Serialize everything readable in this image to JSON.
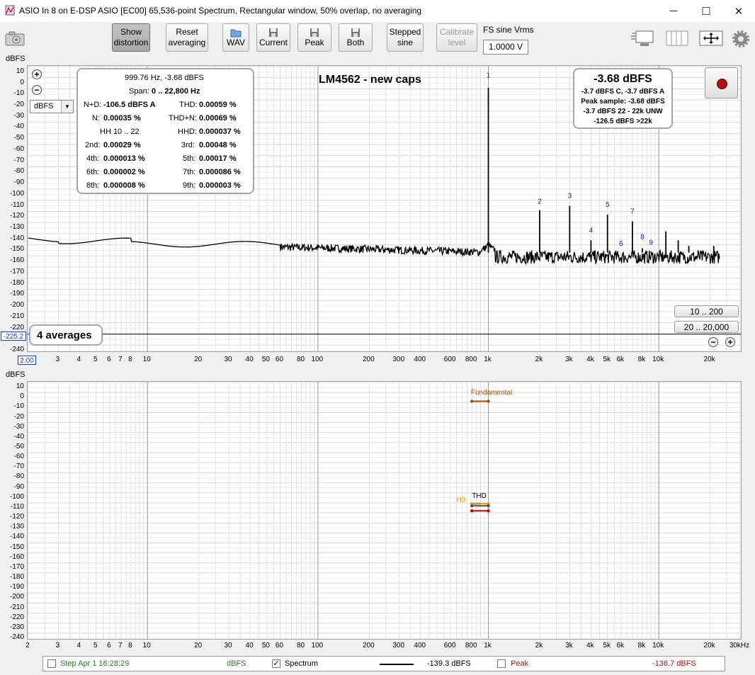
{
  "window": {
    "title": "ASIO In 8 on E-DSP ASIO [EC00] 65,536-point Spectrum, Rectangular window, 50% overlap, no averaging",
    "minimize": "─",
    "maximize": "☐",
    "close": "✕"
  },
  "toolbar": {
    "show_distortion_1": "Show",
    "show_distortion_2": "distortion",
    "reset_1": "Reset",
    "reset_2": "averaging",
    "wav": "WAV",
    "current": "Current",
    "peak": "Peak",
    "both": "Both",
    "stepped_1": "Stepped",
    "stepped_2": "sine",
    "calibrate_1": "Calibrate",
    "calibrate_2": "level",
    "fs_label": "FS sine Vrms",
    "fs_value": "1.0000 V"
  },
  "top_plot": {
    "title": "LM4562 - new caps",
    "unit_label": "dBFS",
    "unit_select": "dBFS",
    "y_ticks": [
      "10",
      "0",
      "-10",
      "-20",
      "-30",
      "-40",
      "-50",
      "-60",
      "-70",
      "-80",
      "-90",
      "-100",
      "-110",
      "-120",
      "-130",
      "-140",
      "-150",
      "-160",
      "-170",
      "-180",
      "-190",
      "-200",
      "-210",
      "-220",
      "-230",
      "-240"
    ],
    "y_cursor": "-225.2",
    "x_cursor": "2.00",
    "averages": "4 averages",
    "range_1": "10 .. 200",
    "range_2": "20 .. 20,000",
    "harmonic_labels": [
      "1",
      "2",
      "3",
      "4",
      "5",
      "6",
      "7",
      "8",
      "9"
    ]
  },
  "x_ticks": [
    "3",
    "4",
    "5",
    "6",
    "7",
    "8",
    "10",
    "20",
    "30",
    "40",
    "50",
    "60",
    "80",
    "100",
    "200",
    "300",
    "400",
    "600",
    "800",
    "1k",
    "2k",
    "3k",
    "4k",
    "5k",
    "6k",
    "8k",
    "10k",
    "20k"
  ],
  "x_ticks_bottom_extra": {
    "start": "2",
    "end": "30kHz"
  },
  "distortion": {
    "header": "999.76 Hz, -3.68 dBFS",
    "span_label": "Span:",
    "span_value": "0 .. 22,800 Hz",
    "nd_label": "N+D:",
    "nd_value": "-106.5 dBFS A",
    "thd_label": "THD:",
    "thd_value": "0.00059 %",
    "n_label": "N:",
    "n_value": "0.00035 %",
    "thdn_label": "THD+N:",
    "thdn_value": "0.00069 %",
    "hh_label": "HH 10 .. 22",
    "hhd_label": "HHD:",
    "hhd_value": "0.000037 %",
    "h2_label": "2nd:",
    "h2_value": "0.00029 %",
    "h3_label": "3rd:",
    "h3_value": "0.00048 %",
    "h4_label": "4th:",
    "h4_value": "0.000013 %",
    "h5_label": "5th:",
    "h5_value": "0.00017 %",
    "h6_label": "6th:",
    "h6_value": "0.000002 %",
    "h7_label": "7th:",
    "h7_value": "0.000086 %",
    "h8_label": "8th:",
    "h8_value": "0.000008 %",
    "h9_label": "9th:",
    "h9_value": "0.000003 %"
  },
  "peak": {
    "big": "-3.68 dBFS",
    "line1": "-3.7 dBFS C, -3.7 dBFS A",
    "line2": "Peak sample: -3.68 dBFS",
    "line3": "-3.7 dBFS 22 - 22k UNW",
    "line4": "-126.5 dBFS >22k"
  },
  "bottom_plot": {
    "unit_label": "dBFS",
    "y_ticks": [
      "10",
      "0",
      "-10",
      "-20",
      "-30",
      "-40",
      "-50",
      "-60",
      "-70",
      "-80",
      "-90",
      "-100",
      "-110",
      "-120",
      "-130",
      "-140",
      "-150",
      "-160",
      "-170",
      "-180",
      "-190",
      "-200",
      "-210",
      "-220",
      "-230",
      "-240"
    ],
    "fundamental_label": "Fundamental",
    "thd_label": "THD",
    "h3_label": "H3",
    "h2_label": "H2"
  },
  "status": {
    "step": "Step Apr 1 16:28:29",
    "unit": "dBFS",
    "spectrum_label": "Spectrum",
    "spectrum_value": "-139.3 dBFS",
    "peak_label": "Peak",
    "peak_value": "-136.7 dBFS"
  },
  "colors": {
    "harmonic_label": "#1a1ab4",
    "fundamental": "#a05010",
    "thd": "#d4a000",
    "h2": "#c00000",
    "status_green": "#2c7a2c",
    "status_red": "#b01010"
  }
}
